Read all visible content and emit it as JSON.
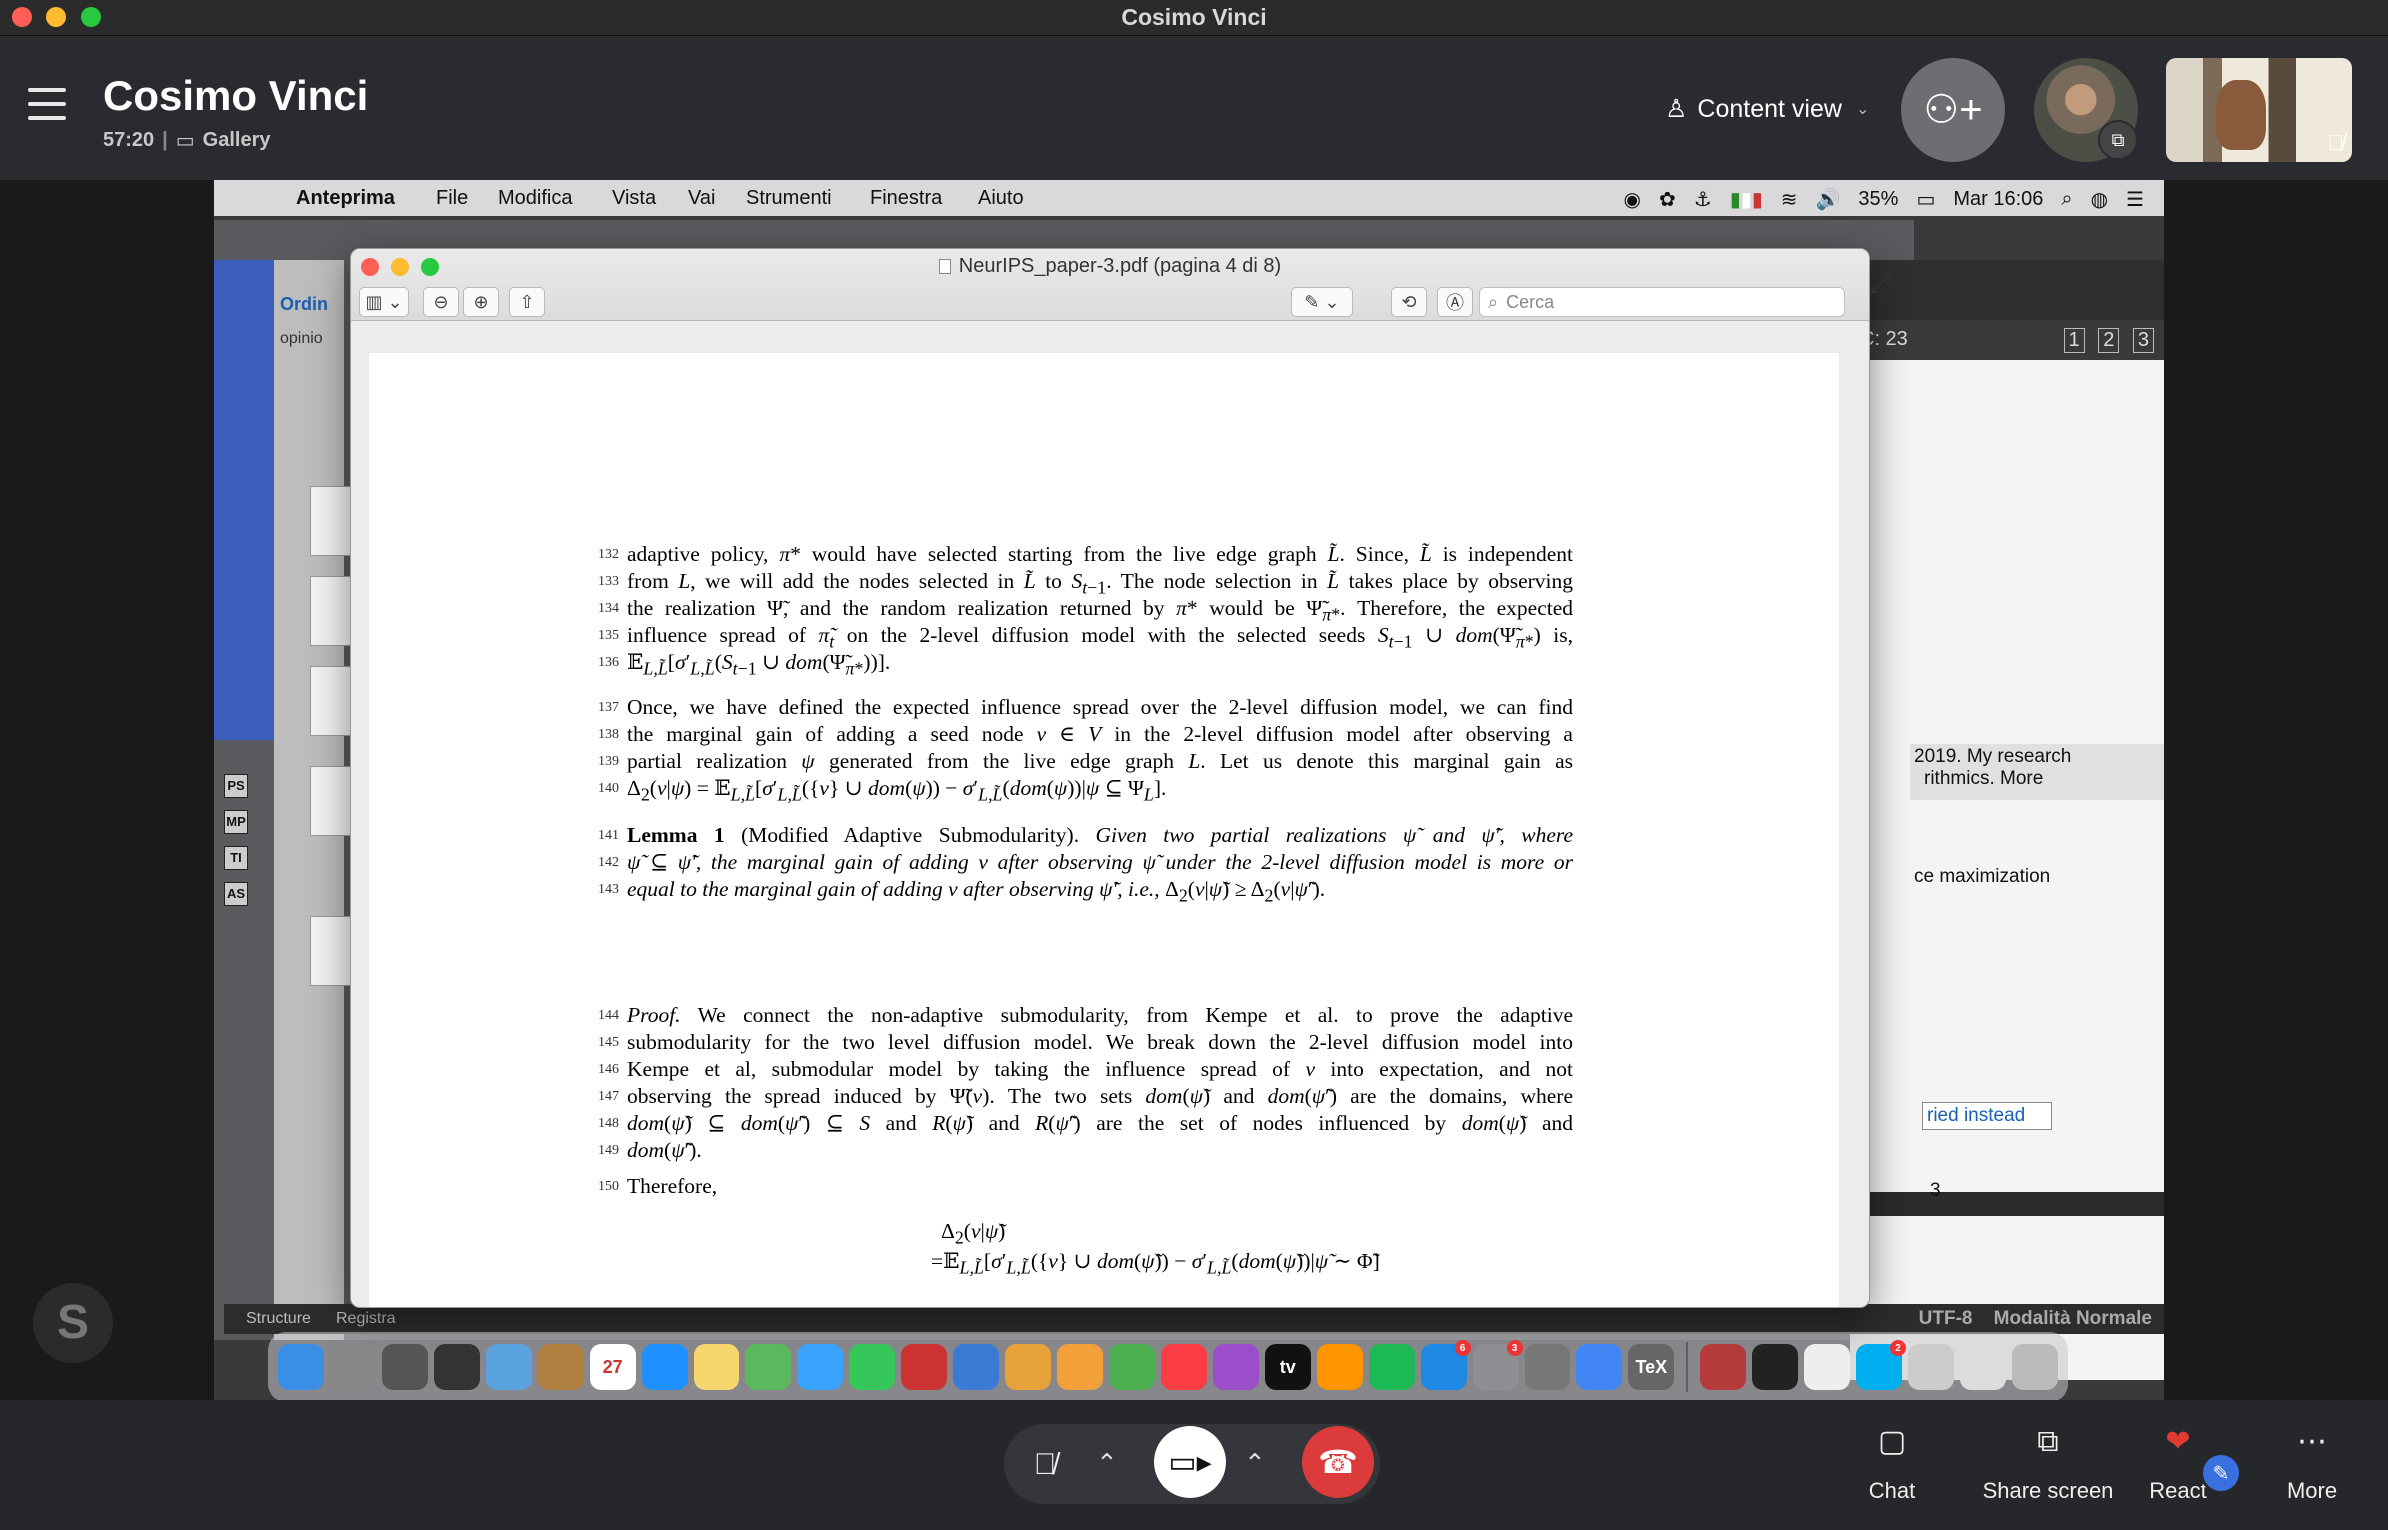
{
  "window": {
    "title": "Cosimo Vinci"
  },
  "call": {
    "name": "Cosimo Vinci",
    "duration": "57:20",
    "layout": "Gallery",
    "content_view": "Content view"
  },
  "mac_menubar": {
    "app": "Anteprima",
    "menus": [
      "File",
      "Modifica",
      "Vista",
      "Vai",
      "Strumenti",
      "Finestra",
      "Aiuto"
    ],
    "battery": "35%",
    "clock": "Mar 16:06"
  },
  "preview": {
    "title": "NeurIPS_paper-3.pdf (pagina 4 di 8)",
    "search_placeholder": "Cerca"
  },
  "background_windows": {
    "left_header": "Ordin",
    "left_sub": "opinio",
    "right_pager_label": "C: 23",
    "pages": [
      "1",
      "2",
      "3"
    ],
    "snippet_1": "2019. My research",
    "snippet_2": "rithmics. More",
    "snippet_3": "ce maximization",
    "tried_button": "ried instead",
    "lower_tab_1": "Structure",
    "lower_tab_2": "Registra",
    "status_encoding": "UTF-8",
    "status_mode": "Modalità Normale",
    "side_digit": "3",
    "struct_icons": [
      "PS",
      "MP",
      "TI",
      "AS"
    ]
  },
  "paper": {
    "lines": [
      {
        "n": "132",
        "html": "adaptive policy, <i>π</i>* would have selected starting from the live edge graph <i>L̃</i>. Since, <i>L̃</i> is independent"
      },
      {
        "n": "133",
        "html": "from <i>L</i>, we will add the nodes selected in <i>L̃</i> to <i>S</i><sub><i>t</i>−1</sub>. The node selection in <i>L̃</i> takes place by observing"
      },
      {
        "n": "134",
        "html": "the realization Ψ̃, and the random realization returned by <i>π</i>* would be Ψ̃<sub><i>π</i>*</sub>. Therefore, the expected"
      },
      {
        "n": "135",
        "html": "influence spread of <i>π̃<sub>t</sub></i> on the 2-level diffusion model with the selected seeds <i>S</i><sub><i>t</i>−1</sub> ∪ <i>dom</i>(Ψ̃<sub><i>π</i>*</sub>) is,"
      },
      {
        "n": "136",
        "html": "𝔼<sub><i>L,L̃</i></sub>[<i>σ</i>′<sub><i>L,L̃</i></sub>(<i>S</i><sub><i>t</i>−1</sub> ∪ <i>dom</i>(Ψ̃<sub><i>π</i>*</sub>))]."
      },
      {
        "n": "137",
        "html": "Once, we have defined the expected influence spread over the 2-level diffusion model, we can find"
      },
      {
        "n": "138",
        "html": "the marginal gain of adding a seed node <i>v</i> ∈ <i>V</i> in the 2-level diffusion model after observing a"
      },
      {
        "n": "139",
        "html": "partial realization <i>ψ</i> generated from the live edge graph <i>L</i>. Let us denote this marginal gain as"
      },
      {
        "n": "140",
        "html": "Δ<sub>2</sub>(<i>v</i>|<i>ψ</i>) = 𝔼<sub><i>L,L̃</i></sub>[<i>σ</i>′<sub><i>L,L̃</i></sub>({<i>v</i>} ∪ <i>dom</i>(<i>ψ</i>)) − <i>σ</i>′<sub><i>L,L̃</i></sub>(<i>dom</i>(<i>ψ</i>))|<i>ψ</i> ⊆ Ψ<sub><i>L</i></sub>]."
      },
      {
        "n": "141",
        "html": "<b>Lemma 1</b> (Modified Adaptive Submodularity). <i>Given two partial realizations ψ̃ and ψ̃′, where</i>"
      },
      {
        "n": "142",
        "html": "<i>ψ̃ ⊆ ψ̃′, the marginal gain of adding v after observing ψ̃ under the 2-level diffusion model is more or</i>"
      },
      {
        "n": "143",
        "html": "<i>equal to the marginal gain of adding v after observing ψ̃′, i.e.,</i> Δ<sub>2</sub>(<i>v</i>|<i>ψ̃</i>) ≥ Δ<sub>2</sub>(<i>v</i>|<i>ψ̃</i>′)."
      },
      {
        "n": "144",
        "html": "<i>Proof.</i> We connect the non-adaptive submodularity, from Kempe et al.  to prove the adaptive"
      },
      {
        "n": "145",
        "html": "submodularity for the two level diffusion model. We break down the 2-level diffusion model into"
      },
      {
        "n": "146",
        "html": "Kempe et al, submodular model by taking the influence spread of <i>v</i> into expectation, and not"
      },
      {
        "n": "147",
        "html": "observing the spread induced by Ψ̃(<i>v</i>). The two sets <i>dom</i>(<i>ψ̃</i>) and <i>dom</i>(<i>ψ̃</i>′) are the domains, where"
      },
      {
        "n": "148",
        "html": "<i>dom</i>(<i>ψ̃</i>) ⊆ <i>dom</i>(<i>ψ̃</i>′) ⊆ <i>S</i> and <i>R</i>(<i>ψ̃</i>) and <i>R</i>(<i>ψ̃</i>′) are the set of nodes influenced by <i>dom</i>(<i>ψ̃</i>) and"
      },
      {
        "n": "149",
        "html": "<i>dom</i>(<i>ψ̃</i>′)."
      },
      {
        "n": "150",
        "html": "Therefore,"
      }
    ],
    "formula_a": "Δ₂(v|ψ̃)",
    "formula_b": "=𝔼L,L̃[σ′L,L̃({v} ∪ dom(ψ̃)) − σ′L,L̃(dom(ψ̃))|ψ̃ ∼ Φ̃]"
  },
  "dock": {
    "apps": [
      "finder-icon",
      "launchpad-icon",
      "apps-grid-icon",
      "dashboard-icon",
      "preview-app-icon",
      "notes-brown-icon",
      "calendar-icon",
      "safari-icon",
      "notes-icon",
      "maps-icon",
      "messages-icon",
      "facetime-icon",
      "photo-booth-icon",
      "keynote-icon",
      "photos-icon",
      "pages-icon",
      "numbers-icon",
      "music-icon",
      "podcasts-icon",
      "tv-icon",
      "books-icon",
      "spotify-icon",
      "app-store-icon",
      "system-prefs-icon",
      "disk-icon",
      "chrome-icon",
      "texmaker-icon"
    ],
    "tv_label": "tv",
    "tex_label": "TeX",
    "badges": {
      "app-store-icon": "6",
      "system-prefs-icon": "3",
      "skype-dock-icon": "2"
    }
  },
  "controls": {
    "chat": "Chat",
    "share": "Share screen",
    "react": "React",
    "more": "More"
  },
  "colors": {
    "hangup": "#dc3b3b",
    "react_heart": "#e53935",
    "accent_blue": "#3a6fe0"
  }
}
